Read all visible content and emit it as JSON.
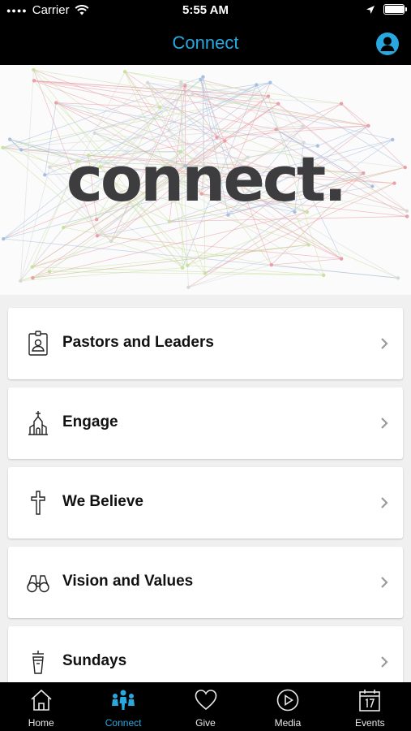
{
  "status_bar": {
    "carrier": "Carrier",
    "time": "5:55 AM",
    "battery_level": 0.95
  },
  "nav": {
    "title": "Connect",
    "profile_icon": "user-icon"
  },
  "hero": {
    "word": "connect."
  },
  "list": {
    "items": [
      {
        "label": "Pastors and Leaders",
        "icon": "id-badge-icon"
      },
      {
        "label": "Engage",
        "icon": "church-icon"
      },
      {
        "label": "We Believe",
        "icon": "cross-icon"
      },
      {
        "label": "Vision and Values",
        "icon": "binoculars-icon"
      },
      {
        "label": "Sundays",
        "icon": "pulpit-icon"
      }
    ]
  },
  "tabs": [
    {
      "label": "Home",
      "icon": "home-icon",
      "active": false
    },
    {
      "label": "Connect",
      "icon": "people-icon",
      "active": true
    },
    {
      "label": "Give",
      "icon": "heart-icon",
      "active": false
    },
    {
      "label": "Media",
      "icon": "play-icon",
      "active": false
    },
    {
      "label": "Events",
      "icon": "calendar-icon",
      "active": false
    }
  ],
  "colors": {
    "accent": "#29a8e0",
    "bar_bg": "#000000",
    "hero_text": "#3d3d3f"
  }
}
